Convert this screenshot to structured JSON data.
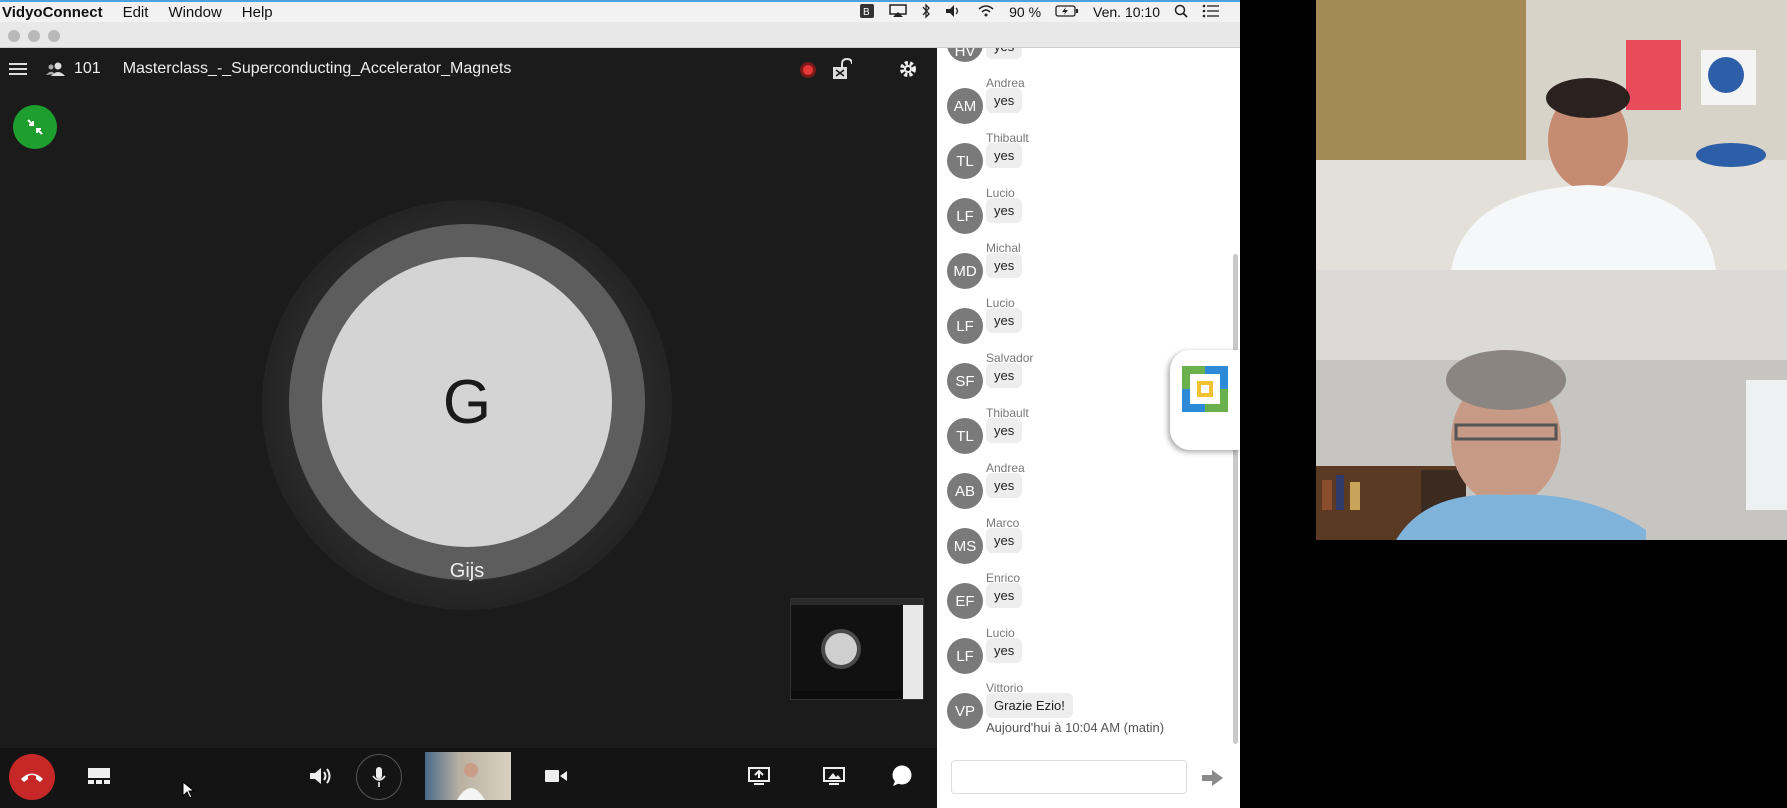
{
  "menubar": {
    "app_name": "VidyoConnect",
    "items": [
      "Edit",
      "Window",
      "Help"
    ],
    "battery": "90 %",
    "clock": "Ven. 10:10"
  },
  "meeting": {
    "participant_count": "101",
    "room_name": "Masterclass_-_Superconducting_Accelerator_Magnets",
    "active_speaker_initial": "G",
    "active_speaker_name": "Gijs"
  },
  "chat": {
    "messages": [
      {
        "sender": "Andrea",
        "initials": "AM",
        "text": "yes"
      },
      {
        "sender": "Thibault",
        "initials": "TL",
        "text": "yes"
      },
      {
        "sender": "Lucio",
        "initials": "LF",
        "text": "yes"
      },
      {
        "sender": "Michal",
        "initials": "MD",
        "text": "yes"
      },
      {
        "sender": "Lucio",
        "initials": "LF",
        "text": "yes"
      },
      {
        "sender": "Salvador",
        "initials": "SF",
        "text": "yes"
      },
      {
        "sender": "Thibault",
        "initials": "TL",
        "text": "yes"
      },
      {
        "sender": "Andrea",
        "initials": "AB",
        "text": "yes"
      },
      {
        "sender": "Marco",
        "initials": "MS",
        "text": "yes"
      },
      {
        "sender": "Enrico",
        "initials": "EF",
        "text": "yes"
      },
      {
        "sender": "Lucio",
        "initials": "LF",
        "text": "yes"
      },
      {
        "sender": "Vittorio",
        "initials": "VP",
        "text": "Grazie Ezio!"
      }
    ],
    "partial_top": {
      "initials": "HV",
      "text": "yes"
    },
    "timestamp": "Aujourd'hui à 10:04 AM (matin)",
    "input_placeholder": ""
  },
  "colors": {
    "accent_green": "#1e9e2e",
    "hangup_red": "#c62828",
    "record_red": "#e53935"
  },
  "icons": [
    "menu-icon",
    "participants-icon",
    "record-icon",
    "lock-icon",
    "gear-icon",
    "collapse-icon",
    "hangup-icon",
    "layout-icon",
    "speaker-icon",
    "microphone-icon",
    "camera-icon",
    "share-screen-icon",
    "share-window-icon",
    "chat-icon",
    "send-icon"
  ]
}
